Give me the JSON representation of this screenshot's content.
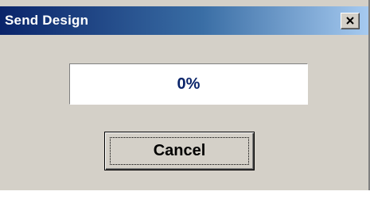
{
  "window": {
    "title": "Send Design",
    "close_icon": "close-icon"
  },
  "progress": {
    "text": "0%",
    "value": 0
  },
  "buttons": {
    "cancel_label": "Cancel"
  },
  "colors": {
    "titlebar_start": "#0a246a",
    "titlebar_end": "#a6caf0",
    "dialog_face": "#d4d0c8",
    "progress_text": "#0a246a"
  }
}
